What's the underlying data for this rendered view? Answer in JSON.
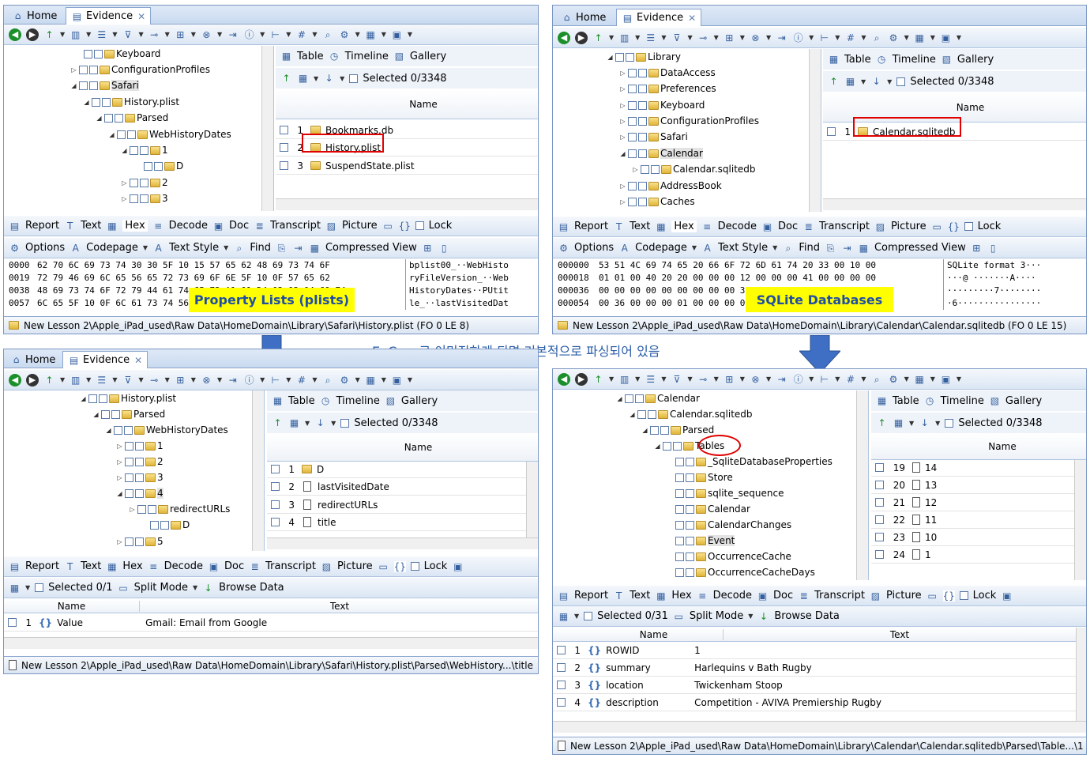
{
  "common": {
    "tab_home": "Home",
    "tab_evidence": "Evidence",
    "view_table": "Table",
    "view_timeline": "Timeline",
    "view_gallery": "Gallery",
    "selected": "Selected 0/3348",
    "col_name": "Name",
    "col_text": "Text",
    "lower_tabs": [
      "Report",
      "Text",
      "Hex",
      "Decode",
      "Doc",
      "Transcript",
      "Picture"
    ],
    "lock": "Lock",
    "opts": {
      "options": "Options",
      "codepage": "Codepage",
      "textstyle": "Text Style",
      "find": "Find",
      "compressed": "Compressed View"
    },
    "split_mode": "Split Mode",
    "browse_data": "Browse Data"
  },
  "q1": {
    "tree": [
      "Keyboard",
      "ConfigurationProfiles",
      "Safari",
      "History.plist",
      "Parsed",
      "WebHistoryDates",
      "1",
      "D",
      "2",
      "3"
    ],
    "rows": [
      {
        "n": "1",
        "name": "Bookmarks.db"
      },
      {
        "n": "2",
        "name": "History.plist"
      },
      {
        "n": "3",
        "name": "SuspendState.plist"
      }
    ],
    "hex": [
      "0000",
      "0019",
      "0038",
      "0057"
    ],
    "hexrows": [
      "62 70 6C 69 73 74 30 30 5F 10 15 57 65 62 48 69 73 74 6F",
      "72 79 46 69 6C 65 56 65 72 73 69 6F 6E 5F 10 0F 57 65 62",
      "48 69 73 74 6F 72 79 44 61 74 65 73 A1 01 D4 02 03 04 69 74",
      "6C 65 5F 10 0F 6C 61 73 74 56 69 73 69 74 65 64 44 61 74"
    ],
    "ascii": [
      "bplist00_··WebHisto",
      "ryFileVersion_··Web",
      "HistoryDates··PUtit",
      "le_··lastVisitedDat"
    ],
    "callout": "Property Lists (plists)",
    "path": "New Lesson 2\\Apple_iPad_used\\Raw Data\\HomeDomain\\Library\\Safari\\History.plist (FO 0 LE 8)"
  },
  "q2": {
    "tree": [
      "Library",
      "DataAccess",
      "Preferences",
      "Keyboard",
      "ConfigurationProfiles",
      "Safari",
      "Calendar",
      "Calendar.sqlitedb",
      "AddressBook",
      "Caches"
    ],
    "rows": [
      {
        "n": "1",
        "name": "Calendar.sqlitedb"
      }
    ],
    "hex": [
      "000000",
      "000018",
      "000036",
      "000054"
    ],
    "hexrows": [
      "53 51 4C 69 74 65 20 66 6F 72 6D 61 74 20 33 00 10 00",
      "01 01 00 40 20 20 00 00 00 12 00 00 00 41 00 00 00 00",
      "00 00 00 00 00 00 00 00 00 37 00 00 00 00 00 00 00 00",
      "00 36 00 00 00 01 00 00 00 00 00 00 00 00 00 00 00 00"
    ],
    "ascii": [
      "SQLite format 3···",
      "···@ ·······A····",
      "·········7········",
      "·6················"
    ],
    "callout": "SQLite Databases",
    "path": "New Lesson 2\\Apple_iPad_used\\Raw Data\\HomeDomain\\Library\\Calendar\\Calendar.sqlitedb (FO 0 LE 15)"
  },
  "caption": "EnCase로 이미징하게 되면 기본적으로 파싱되어 있음",
  "q3": {
    "tree": [
      "History.plist",
      "Parsed",
      "WebHistoryDates",
      "1",
      "2",
      "3",
      "4",
      "redirectURLs",
      "D",
      "5"
    ],
    "rows": [
      {
        "n": "1",
        "name": "D"
      },
      {
        "n": "2",
        "name": "lastVisitedDate"
      },
      {
        "n": "3",
        "name": "redirectURLs"
      },
      {
        "n": "4",
        "name": "title"
      }
    ],
    "selected_small": "Selected 0/1",
    "data_rows": [
      {
        "n": "1",
        "name": "Value",
        "text": "Gmail: Email from Google"
      }
    ],
    "path": "New Lesson 2\\Apple_iPad_used\\Raw Data\\HomeDomain\\Library\\Safari\\History.plist\\Parsed\\WebHistory...\\title"
  },
  "q4": {
    "tree": [
      "Calendar",
      "Calendar.sqlitedb",
      "Parsed",
      "Tables",
      "_SqliteDatabaseProperties",
      "Store",
      "sqlite_sequence",
      "Calendar",
      "CalendarChanges",
      "Event",
      "OccurrenceCache",
      "OccurrenceCacheDays"
    ],
    "rows": [
      {
        "n": "19",
        "name": "14"
      },
      {
        "n": "20",
        "name": "13"
      },
      {
        "n": "21",
        "name": "12"
      },
      {
        "n": "22",
        "name": "11"
      },
      {
        "n": "23",
        "name": "10"
      },
      {
        "n": "24",
        "name": "1"
      }
    ],
    "selected_small": "Selected 0/31",
    "data_rows": [
      {
        "n": "1",
        "name": "ROWID",
        "text": "1"
      },
      {
        "n": "2",
        "name": "summary",
        "text": "Harlequins v Bath Rugby"
      },
      {
        "n": "3",
        "name": "location",
        "text": "Twickenham Stoop"
      },
      {
        "n": "4",
        "name": "description",
        "text": "Competition - AVIVA Premiership Rugby"
      }
    ],
    "path": "New Lesson 2\\Apple_iPad_used\\Raw Data\\HomeDomain\\Library\\Calendar\\Calendar.sqlitedb\\Parsed\\Table...\\1"
  }
}
